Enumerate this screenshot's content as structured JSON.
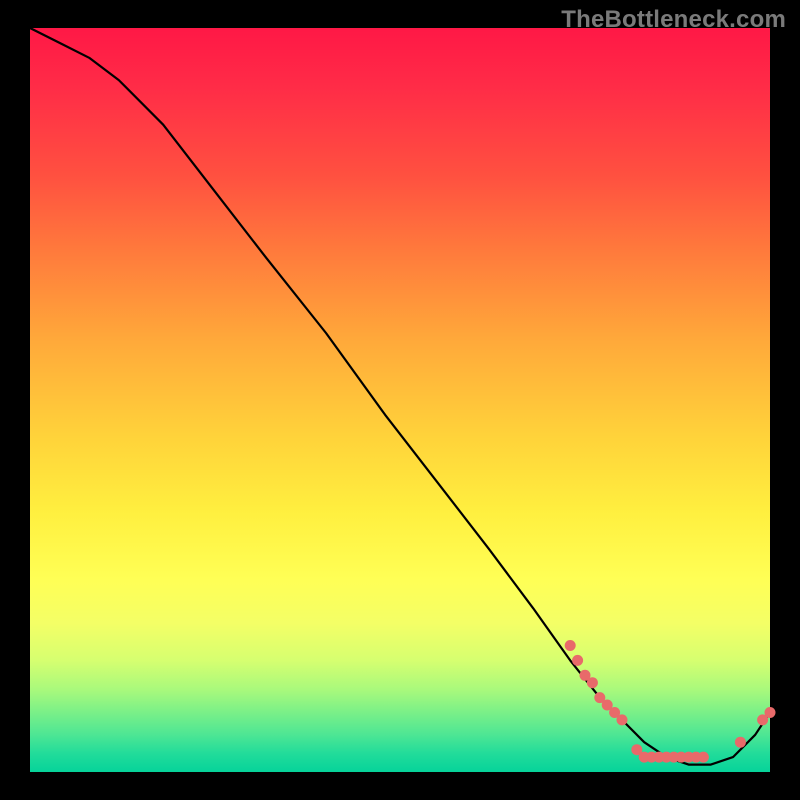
{
  "watermark": "TheBottleneck.com",
  "colors": {
    "background": "#000000",
    "gradient_top": "#ff1846",
    "gradient_mid": "#ffd33a",
    "gradient_bottom": "#06d39a",
    "curve": "#000000",
    "dots": "#e86a6a"
  },
  "chart_data": {
    "type": "line",
    "title": "",
    "xlabel": "",
    "ylabel": "",
    "xlim": [
      0,
      100
    ],
    "ylim": [
      0,
      100
    ],
    "grid": false,
    "legend": false,
    "series": [
      {
        "name": "curve",
        "x": [
          0,
          4,
          8,
          12,
          18,
          25,
          32,
          40,
          48,
          55,
          62,
          68,
          73,
          77,
          80,
          83,
          86,
          89,
          92,
          95,
          98,
          100
        ],
        "y": [
          100,
          98,
          96,
          93,
          87,
          78,
          69,
          59,
          48,
          39,
          30,
          22,
          15,
          10,
          7,
          4,
          2,
          1,
          1,
          2,
          5,
          8
        ]
      }
    ],
    "markers": [
      {
        "name": "cluster",
        "points": [
          {
            "x": 73,
            "y": 17
          },
          {
            "x": 74,
            "y": 15
          },
          {
            "x": 75,
            "y": 13
          },
          {
            "x": 76,
            "y": 12
          },
          {
            "x": 77,
            "y": 10
          },
          {
            "x": 78,
            "y": 9
          },
          {
            "x": 79,
            "y": 8
          },
          {
            "x": 80,
            "y": 7
          },
          {
            "x": 82,
            "y": 3
          },
          {
            "x": 83,
            "y": 2
          },
          {
            "x": 84,
            "y": 2
          },
          {
            "x": 85,
            "y": 2
          },
          {
            "x": 86,
            "y": 2
          },
          {
            "x": 87,
            "y": 2
          },
          {
            "x": 88,
            "y": 2
          },
          {
            "x": 89,
            "y": 2
          },
          {
            "x": 90,
            "y": 2
          },
          {
            "x": 91,
            "y": 2
          },
          {
            "x": 96,
            "y": 4
          },
          {
            "x": 99,
            "y": 7
          },
          {
            "x": 100,
            "y": 8
          }
        ]
      }
    ]
  }
}
